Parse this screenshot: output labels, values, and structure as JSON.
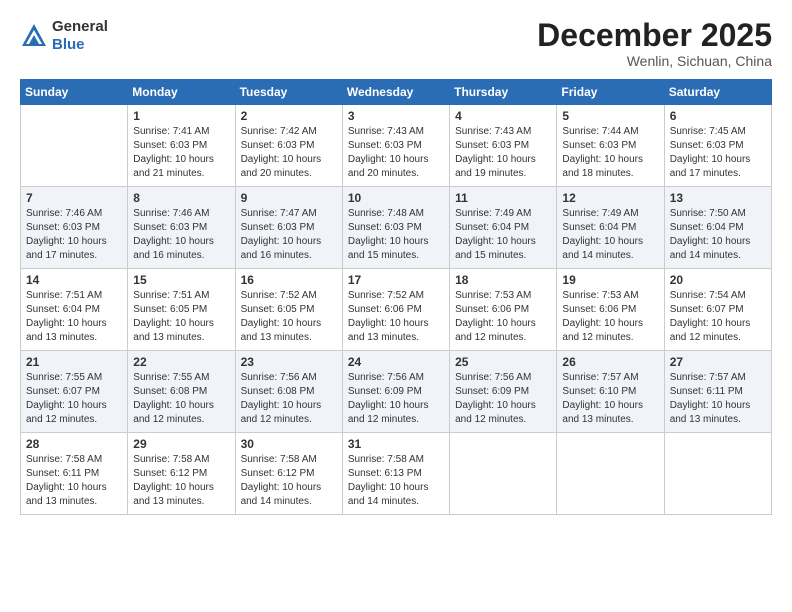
{
  "header": {
    "logo_line1": "General",
    "logo_line2": "Blue",
    "month": "December 2025",
    "location": "Wenlin, Sichuan, China"
  },
  "days_of_week": [
    "Sunday",
    "Monday",
    "Tuesday",
    "Wednesday",
    "Thursday",
    "Friday",
    "Saturday"
  ],
  "weeks": [
    [
      {
        "day": "",
        "info": ""
      },
      {
        "day": "1",
        "info": "Sunrise: 7:41 AM\nSunset: 6:03 PM\nDaylight: 10 hours\nand 21 minutes."
      },
      {
        "day": "2",
        "info": "Sunrise: 7:42 AM\nSunset: 6:03 PM\nDaylight: 10 hours\nand 20 minutes."
      },
      {
        "day": "3",
        "info": "Sunrise: 7:43 AM\nSunset: 6:03 PM\nDaylight: 10 hours\nand 20 minutes."
      },
      {
        "day": "4",
        "info": "Sunrise: 7:43 AM\nSunset: 6:03 PM\nDaylight: 10 hours\nand 19 minutes."
      },
      {
        "day": "5",
        "info": "Sunrise: 7:44 AM\nSunset: 6:03 PM\nDaylight: 10 hours\nand 18 minutes."
      },
      {
        "day": "6",
        "info": "Sunrise: 7:45 AM\nSunset: 6:03 PM\nDaylight: 10 hours\nand 17 minutes."
      }
    ],
    [
      {
        "day": "7",
        "info": "Sunrise: 7:46 AM\nSunset: 6:03 PM\nDaylight: 10 hours\nand 17 minutes."
      },
      {
        "day": "8",
        "info": "Sunrise: 7:46 AM\nSunset: 6:03 PM\nDaylight: 10 hours\nand 16 minutes."
      },
      {
        "day": "9",
        "info": "Sunrise: 7:47 AM\nSunset: 6:03 PM\nDaylight: 10 hours\nand 16 minutes."
      },
      {
        "day": "10",
        "info": "Sunrise: 7:48 AM\nSunset: 6:03 PM\nDaylight: 10 hours\nand 15 minutes."
      },
      {
        "day": "11",
        "info": "Sunrise: 7:49 AM\nSunset: 6:04 PM\nDaylight: 10 hours\nand 15 minutes."
      },
      {
        "day": "12",
        "info": "Sunrise: 7:49 AM\nSunset: 6:04 PM\nDaylight: 10 hours\nand 14 minutes."
      },
      {
        "day": "13",
        "info": "Sunrise: 7:50 AM\nSunset: 6:04 PM\nDaylight: 10 hours\nand 14 minutes."
      }
    ],
    [
      {
        "day": "14",
        "info": "Sunrise: 7:51 AM\nSunset: 6:04 PM\nDaylight: 10 hours\nand 13 minutes."
      },
      {
        "day": "15",
        "info": "Sunrise: 7:51 AM\nSunset: 6:05 PM\nDaylight: 10 hours\nand 13 minutes."
      },
      {
        "day": "16",
        "info": "Sunrise: 7:52 AM\nSunset: 6:05 PM\nDaylight: 10 hours\nand 13 minutes."
      },
      {
        "day": "17",
        "info": "Sunrise: 7:52 AM\nSunset: 6:06 PM\nDaylight: 10 hours\nand 13 minutes."
      },
      {
        "day": "18",
        "info": "Sunrise: 7:53 AM\nSunset: 6:06 PM\nDaylight: 10 hours\nand 12 minutes."
      },
      {
        "day": "19",
        "info": "Sunrise: 7:53 AM\nSunset: 6:06 PM\nDaylight: 10 hours\nand 12 minutes."
      },
      {
        "day": "20",
        "info": "Sunrise: 7:54 AM\nSunset: 6:07 PM\nDaylight: 10 hours\nand 12 minutes."
      }
    ],
    [
      {
        "day": "21",
        "info": "Sunrise: 7:55 AM\nSunset: 6:07 PM\nDaylight: 10 hours\nand 12 minutes."
      },
      {
        "day": "22",
        "info": "Sunrise: 7:55 AM\nSunset: 6:08 PM\nDaylight: 10 hours\nand 12 minutes."
      },
      {
        "day": "23",
        "info": "Sunrise: 7:56 AM\nSunset: 6:08 PM\nDaylight: 10 hours\nand 12 minutes."
      },
      {
        "day": "24",
        "info": "Sunrise: 7:56 AM\nSunset: 6:09 PM\nDaylight: 10 hours\nand 12 minutes."
      },
      {
        "day": "25",
        "info": "Sunrise: 7:56 AM\nSunset: 6:09 PM\nDaylight: 10 hours\nand 12 minutes."
      },
      {
        "day": "26",
        "info": "Sunrise: 7:57 AM\nSunset: 6:10 PM\nDaylight: 10 hours\nand 13 minutes."
      },
      {
        "day": "27",
        "info": "Sunrise: 7:57 AM\nSunset: 6:11 PM\nDaylight: 10 hours\nand 13 minutes."
      }
    ],
    [
      {
        "day": "28",
        "info": "Sunrise: 7:58 AM\nSunset: 6:11 PM\nDaylight: 10 hours\nand 13 minutes."
      },
      {
        "day": "29",
        "info": "Sunrise: 7:58 AM\nSunset: 6:12 PM\nDaylight: 10 hours\nand 13 minutes."
      },
      {
        "day": "30",
        "info": "Sunrise: 7:58 AM\nSunset: 6:12 PM\nDaylight: 10 hours\nand 14 minutes."
      },
      {
        "day": "31",
        "info": "Sunrise: 7:58 AM\nSunset: 6:13 PM\nDaylight: 10 hours\nand 14 minutes."
      },
      {
        "day": "",
        "info": ""
      },
      {
        "day": "",
        "info": ""
      },
      {
        "day": "",
        "info": ""
      }
    ]
  ]
}
